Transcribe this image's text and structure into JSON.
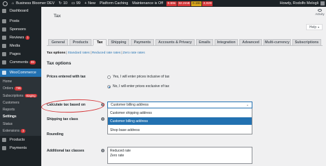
{
  "adminbar": {
    "site_name": "Business Bloomer DEV",
    "updates": "10",
    "comments": "99",
    "new_label": "New",
    "platform": "Platform Caching",
    "maintenance": "Maintenance is Off",
    "perf": [
      "0.69s",
      "32.2mB",
      "0.19s",
      "2,029"
    ],
    "howdy": "Howdy, Rodolfo Melogli"
  },
  "sidebar": {
    "items": [
      {
        "label": "Dashboard",
        "icon": "dashboard-icon"
      },
      {
        "label": "Posts",
        "icon": "pin-icon"
      },
      {
        "label": "Sponsors",
        "icon": "pin-icon"
      },
      {
        "label": "Reviews",
        "icon": "pin-icon",
        "badge": "1"
      },
      {
        "label": "Media",
        "icon": "media-icon"
      },
      {
        "label": "Pages",
        "icon": "page-icon"
      },
      {
        "label": "Comments",
        "icon": "comment-icon",
        "badge": "99"
      },
      {
        "label": "WooCommerce",
        "icon": "woo-icon"
      }
    ],
    "submenu": [
      {
        "label": "Home"
      },
      {
        "label": "Orders",
        "badge": "795"
      },
      {
        "label": "Subscriptions",
        "badge": "staging"
      },
      {
        "label": "Customers"
      },
      {
        "label": "Reports"
      },
      {
        "label": "Settings",
        "current": true
      },
      {
        "label": "Status"
      },
      {
        "label": "Extensions",
        "badge": "3"
      }
    ],
    "after": [
      {
        "label": "Products",
        "icon": "product-icon"
      },
      {
        "label": "Payments",
        "icon": "payments-icon"
      }
    ]
  },
  "main": {
    "title": "Tax",
    "activity": "Activity",
    "help": "Help",
    "tabs": [
      "General",
      "Products",
      "Tax",
      "Shipping",
      "Payments",
      "Accounts & Privacy",
      "Emails",
      "Integration",
      "Advanced",
      "Multi-currency",
      "Subscriptions"
    ],
    "sections": [
      "Tax options",
      "Standard rates",
      "Reduced rate rates",
      "Zero rate rates"
    ],
    "heading": "Tax options",
    "prices_label": "Prices entered with tax",
    "prices_options": [
      "Yes, I will enter prices inclusive of tax",
      "No, I will enter prices exclusive of tax"
    ],
    "calc_label": "Calculate tax based on",
    "calc_value": "Customer billing address",
    "calc_options": [
      "Customer shipping address",
      "Customer billing address",
      "Shop base address"
    ],
    "shipping_label": "Shipping tax class",
    "rounding_label": "Rounding",
    "additional_label": "Additional tax classes",
    "additional_lines": [
      "Reduced rate",
      "Zero rate"
    ]
  },
  "colors": {
    "accent": "#2271b1",
    "annotation": "#d63638",
    "admin_bg": "#1d2327"
  }
}
